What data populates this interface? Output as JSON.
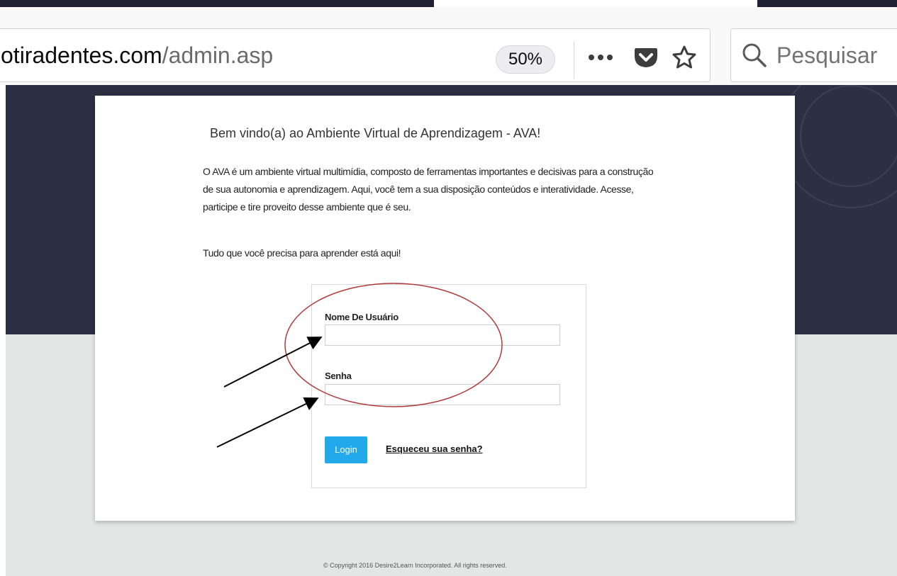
{
  "browser": {
    "url_domain": "otiradentes.com",
    "url_path": "/admin.asp",
    "zoom": "50%",
    "search_placeholder": "Pesquisar",
    "icons": [
      "more-icon",
      "pocket-icon",
      "bookmark-star-icon",
      "search-icon"
    ]
  },
  "page": {
    "welcome_title": "Bem vindo(a) ao Ambiente Virtual de Aprendizagem - AVA!",
    "intro_text": "O AVA é um ambiente virtual multimídia, composto de ferramentas importantes e decisivas para a construção de sua autonomia e aprendizagem. Aqui, você tem a sua disposição conteúdos e interatividade. Acesse, participe e tire proveito desse ambiente que é seu.",
    "tagline": "Tudo que você precisa para aprender está aqui!",
    "login": {
      "username_label": "Nome De Usuário",
      "username_value": "",
      "password_label": "Senha",
      "password_value": "",
      "login_button": "Login",
      "forgot_link": "Esqueceu sua senha?"
    },
    "footer": "© Copyright 2016 Desire2Learn Incorporated. All rights reserved."
  },
  "annotations": {
    "circle_color": "#b03a3a",
    "arrow_color": "#000000"
  }
}
